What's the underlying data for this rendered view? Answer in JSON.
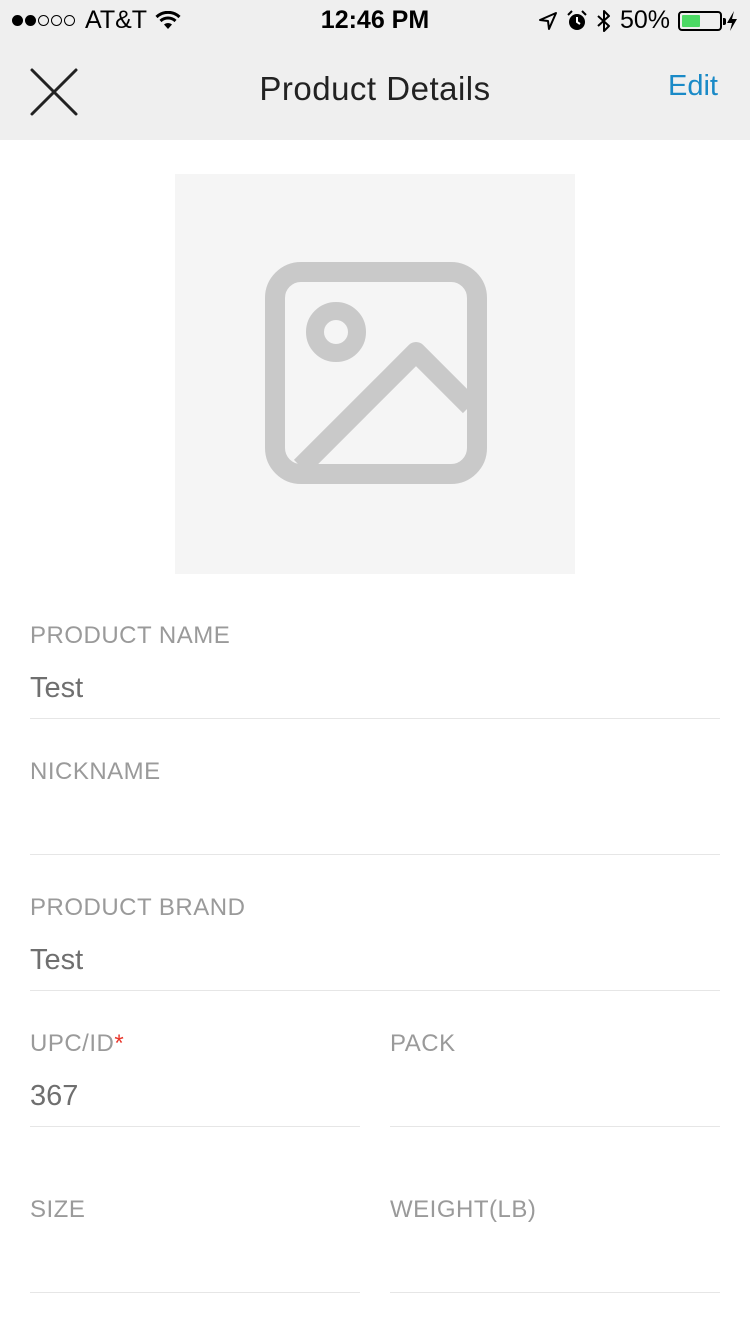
{
  "status_bar": {
    "carrier": "AT&T",
    "time": "12:46 PM",
    "battery_percent": "50%",
    "battery_level": 0.5,
    "signal_bars_filled": 2,
    "signal_bars_total": 5
  },
  "nav": {
    "title": "Product Details",
    "edit_label": "Edit",
    "close_icon": "close-icon"
  },
  "image": {
    "icon": "image-placeholder-icon"
  },
  "fields": {
    "product_name": {
      "label": "PRODUCT NAME",
      "value": "Test"
    },
    "nickname": {
      "label": "NICKNAME",
      "value": ""
    },
    "product_brand": {
      "label": "PRODUCT BRAND",
      "value": "Test"
    },
    "upc_id": {
      "label": "UPC/ID",
      "required_mark": "*",
      "value": "367"
    },
    "pack": {
      "label": "PACK",
      "value": ""
    },
    "size": {
      "label": "SIZE",
      "value": ""
    },
    "weight": {
      "label": "WEIGHT(LB)",
      "value": ""
    }
  },
  "colors": {
    "accent": "#1a8ac7",
    "required": "#e8372c",
    "battery": "#4cd964"
  }
}
